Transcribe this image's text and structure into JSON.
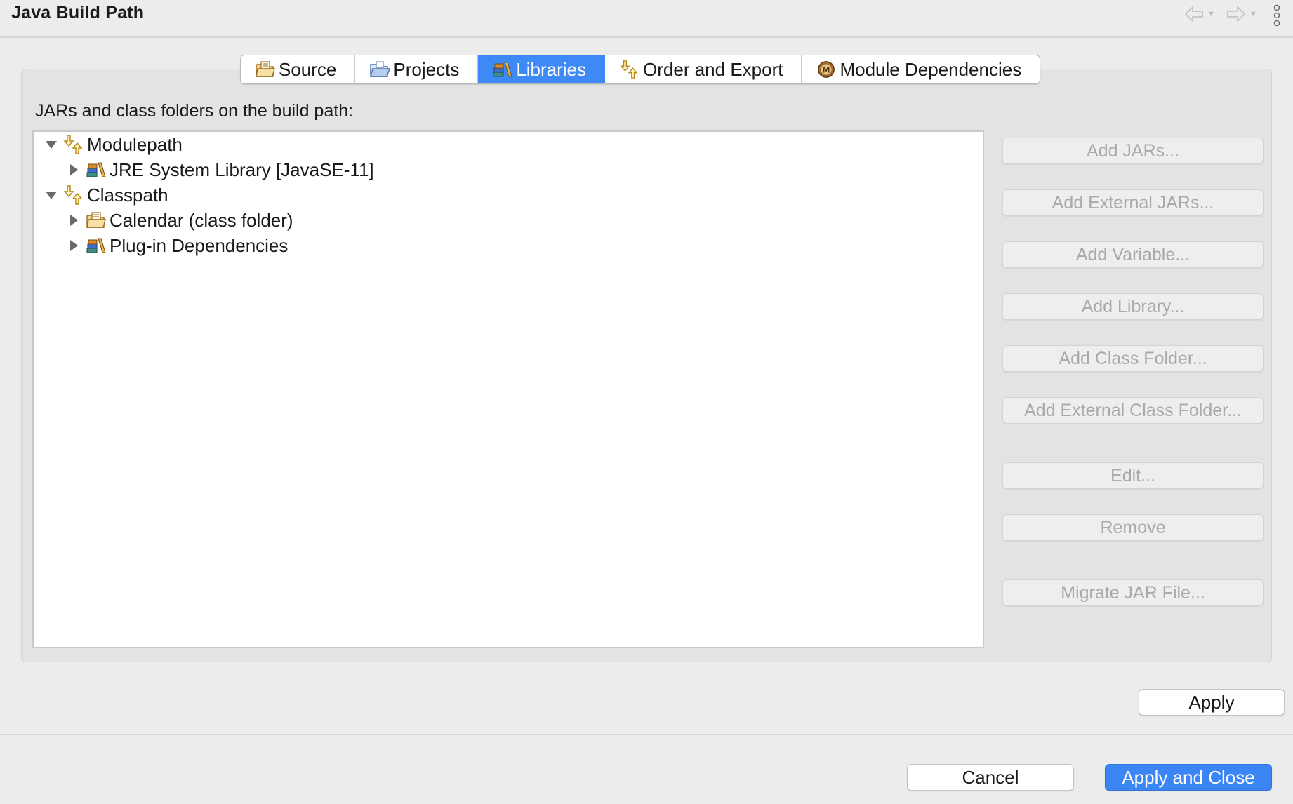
{
  "header": {
    "title": "Java Build Path",
    "back_icon": "back-arrow-icon",
    "forward_icon": "forward-arrow-icon",
    "menu_icon": "vertical-dots-icon"
  },
  "tabs": [
    {
      "label": "Source",
      "icon": "source-folder-icon",
      "active": false
    },
    {
      "label": "Projects",
      "icon": "projects-folder-icon",
      "active": false
    },
    {
      "label": "Libraries",
      "icon": "libraries-icon",
      "active": true
    },
    {
      "label": "Order and Export",
      "icon": "order-export-icon",
      "active": false
    },
    {
      "label": "Module Dependencies",
      "icon": "module-icon",
      "active": false
    }
  ],
  "libraries": {
    "list_label": "JARs and class folders on the build path:",
    "tree": [
      {
        "label": "Modulepath",
        "expanded": true,
        "icon": "modulepath-icon"
      },
      {
        "label": "JRE System Library [JavaSE-11]",
        "expanded": false,
        "icon": "library-icon"
      },
      {
        "label": "Classpath",
        "expanded": true,
        "icon": "classpath-icon"
      },
      {
        "label": "Calendar (class folder)",
        "expanded": false,
        "icon": "class-folder-icon"
      },
      {
        "label": "Plug-in Dependencies",
        "expanded": false,
        "icon": "library-icon"
      }
    ],
    "buttons": [
      "Add JARs...",
      "Add External JARs...",
      "Add Variable...",
      "Add Library...",
      "Add Class Folder...",
      "Add External Class Folder...",
      "Edit...",
      "Remove",
      "Migrate JAR File..."
    ]
  },
  "actions": {
    "apply": "Apply",
    "cancel": "Cancel",
    "apply_and_close": "Apply and Close"
  },
  "colors": {
    "accent": "#3d8af7",
    "disabled_text": "#a9a9a9",
    "dialog_bg": "#ececec"
  }
}
